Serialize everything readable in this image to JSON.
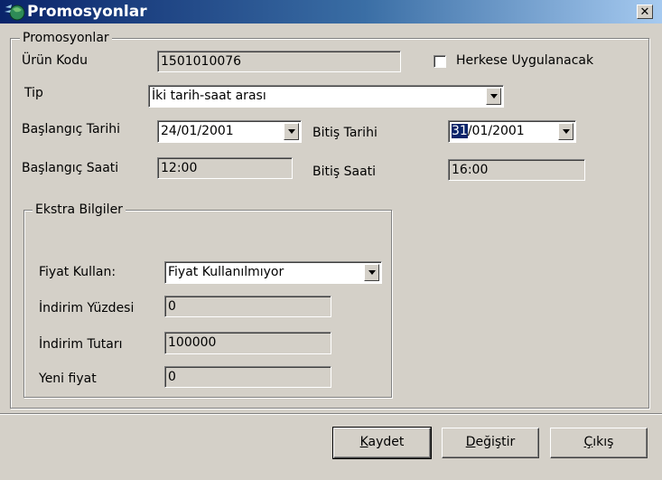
{
  "window": {
    "title": "Promosyonlar",
    "close_glyph": "✕",
    "icon": "app-globe-icon"
  },
  "group_main": {
    "legend": "Promosyonlar"
  },
  "urun_kodu": {
    "label": "Ürün Kodu",
    "value": "1501010076"
  },
  "herkese": {
    "label": "Herkese Uygulanacak",
    "checked": false
  },
  "tip": {
    "label": "Tip",
    "value": "İki tarih-saat arası"
  },
  "baslangic_tarihi": {
    "label": "Başlangıç Tarihi",
    "value": "24/01/2001"
  },
  "bitis_tarihi": {
    "label": "Bitiş Tarihi",
    "value_selected": "31",
    "value_rest": "/01/2001"
  },
  "baslangic_saati": {
    "label": "Başlangıç Saati",
    "value": "12:00"
  },
  "bitis_saati": {
    "label": "Bitiş Saati",
    "value": "16:00"
  },
  "group_extra": {
    "legend": "Ekstra Bilgiler"
  },
  "fiyat_kullan": {
    "label": "Fiyat Kullan:",
    "value": "Fiyat Kullanılmıyor"
  },
  "indirim_yuzdesi": {
    "label": "İndirim Yüzdesi",
    "value": "0"
  },
  "indirim_tutari": {
    "label": "İndirim Tutarı",
    "value": "100000"
  },
  "yeni_fiyat": {
    "label": "Yeni fiyat",
    "value": "0"
  },
  "buttons": {
    "kaydet": {
      "mnemonic": "K",
      "rest": "aydet"
    },
    "degistir": {
      "mnemonic": "D",
      "rest": "eğiştir"
    },
    "cikis": {
      "mnemonic": "Ç",
      "rest": "ıkış"
    }
  },
  "colors": {
    "face": "#d4d0c8",
    "title_start": "#0a246a",
    "title_end": "#a6caf0",
    "highlight": "#0a246a"
  }
}
